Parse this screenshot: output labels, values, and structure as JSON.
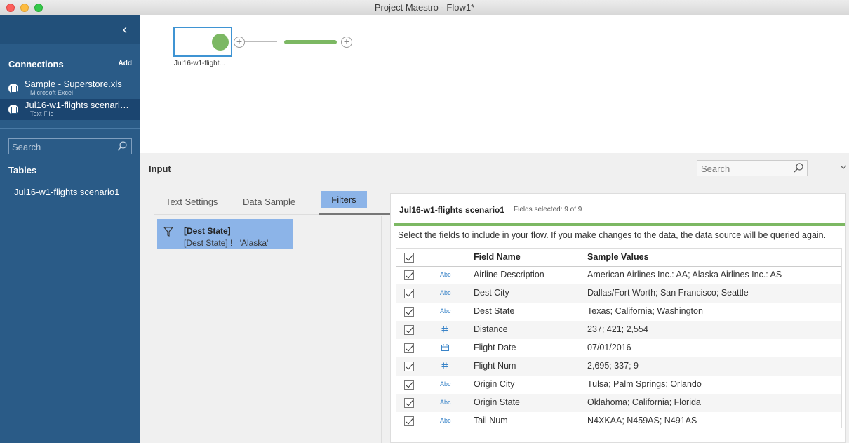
{
  "window": {
    "title": "Project Maestro - Flow1*"
  },
  "sidebar": {
    "collapse_symbol": "‹",
    "connections_title": "Connections",
    "add_label": "Add",
    "connections": [
      {
        "name": "Sample - Superstore.xls",
        "type": "Microsoft Excel"
      },
      {
        "name": "Jul16-w1-flights scenario1",
        "type": "Text File"
      }
    ],
    "search_placeholder": "Search",
    "tables_title": "Tables",
    "tables": [
      "Jul16-w1-flights scenario1"
    ]
  },
  "canvas": {
    "node_label": "Jul16-w1-flight..."
  },
  "panel": {
    "title": "Input",
    "search_placeholder": "Search",
    "tabs": [
      "Text Settings",
      "Data Sample",
      "Filters"
    ],
    "active_tab": "Filters",
    "filter": {
      "title": "[Dest State]",
      "expression": "[Dest State] != 'Alaska'"
    },
    "fields": {
      "source_name": "Jul16-w1-flights scenario1",
      "count_label": "Fields selected: 9 of 9",
      "instructions": "Select the fields to include in your flow. If you make changes to the data, the data source will be queried again.",
      "headers": {
        "name": "Field Name",
        "values": "Sample Values"
      },
      "rows": [
        {
          "type": "Abc",
          "name": "Airline Description",
          "values": "American Airlines Inc.: AA; Alaska Airlines Inc.: AS"
        },
        {
          "type": "Abc",
          "name": "Dest City",
          "values": "Dallas/Fort Worth; San Francisco; Seattle"
        },
        {
          "type": "Abc",
          "name": "Dest State",
          "values": "Texas; California; Washington"
        },
        {
          "type": "#",
          "name": "Distance",
          "values": "237; 421; 2,554"
        },
        {
          "type": "date",
          "name": "Flight Date",
          "values": "07/01/2016"
        },
        {
          "type": "#",
          "name": "Flight Num",
          "values": "2,695; 337; 9"
        },
        {
          "type": "Abc",
          "name": "Origin City",
          "values": "Tulsa; Palm Springs; Orlando"
        },
        {
          "type": "Abc",
          "name": "Origin State",
          "values": "Oklahoma; California; Florida"
        },
        {
          "type": "Abc",
          "name": "Tail Num",
          "values": "N4XKAA; N459AS; N491AS"
        }
      ]
    }
  }
}
